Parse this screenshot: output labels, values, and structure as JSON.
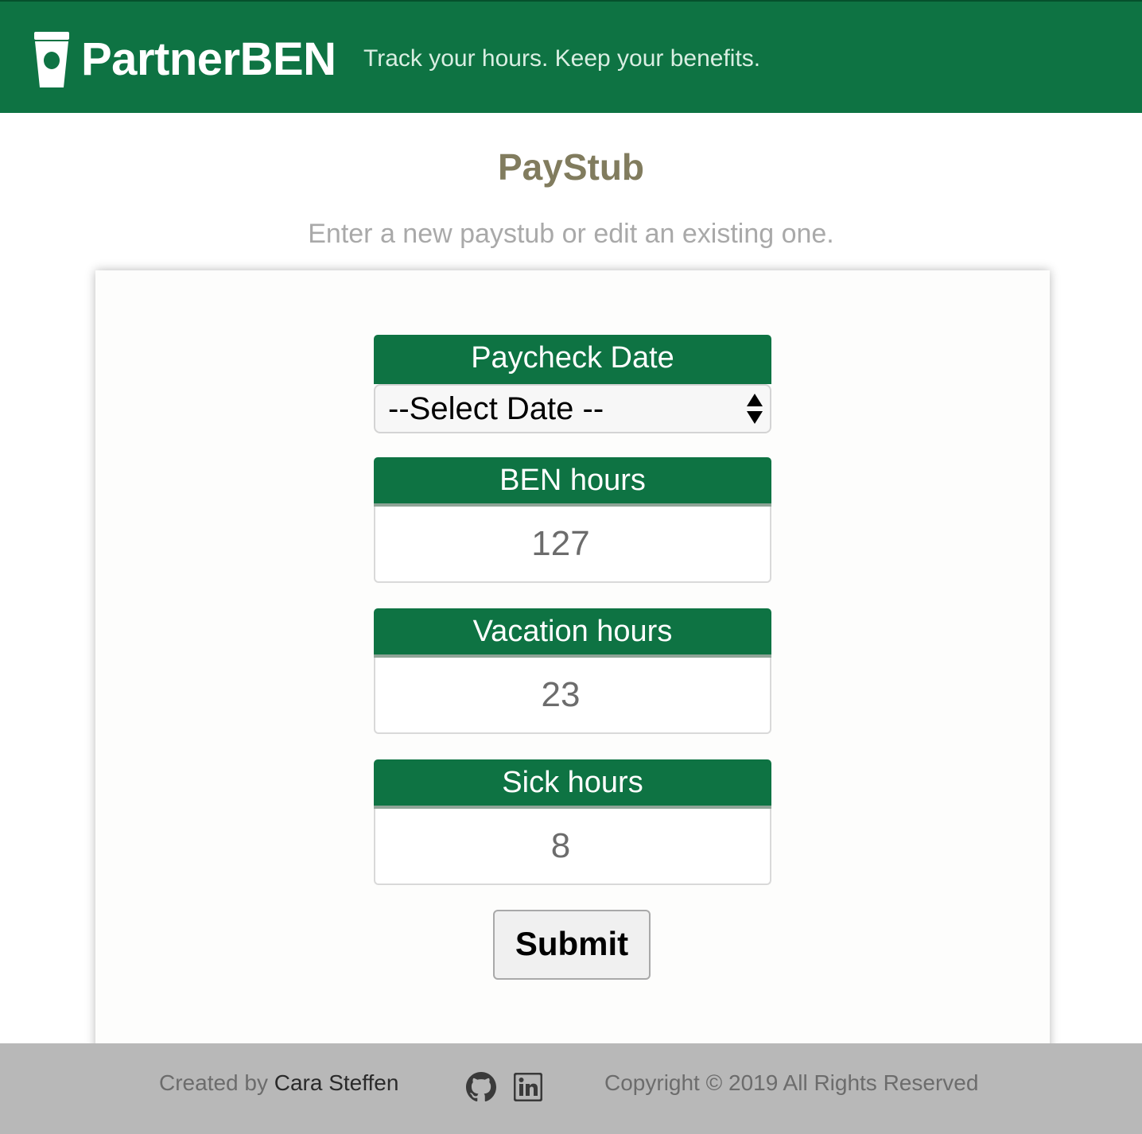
{
  "header": {
    "brand": "PartnerBEN",
    "tagline": "Track your hours. Keep your benefits.",
    "logo_icon": "coffee-cup-icon"
  },
  "page": {
    "title": "PayStub",
    "subtitle": "Enter a new paystub or edit an existing one."
  },
  "form": {
    "paycheck_date": {
      "label": "Paycheck Date",
      "selected": "--Select Date --"
    },
    "ben_hours": {
      "label": "BEN hours",
      "value": "127"
    },
    "vacation_hours": {
      "label": "Vacation hours",
      "value": "23"
    },
    "sick_hours": {
      "label": "Sick hours",
      "value": "8"
    },
    "submit_label": "Submit"
  },
  "footer": {
    "created_by": "Created by",
    "author": "Cara Steffen",
    "github_icon": "github-icon",
    "linkedin_icon": "linkedin-icon",
    "copyright": "Copyright © 2019 All Rights Reserved"
  },
  "colors": {
    "brand_green": "#0e7343",
    "title_olive": "#817c5e",
    "footer_gray": "#b8b8b8"
  }
}
